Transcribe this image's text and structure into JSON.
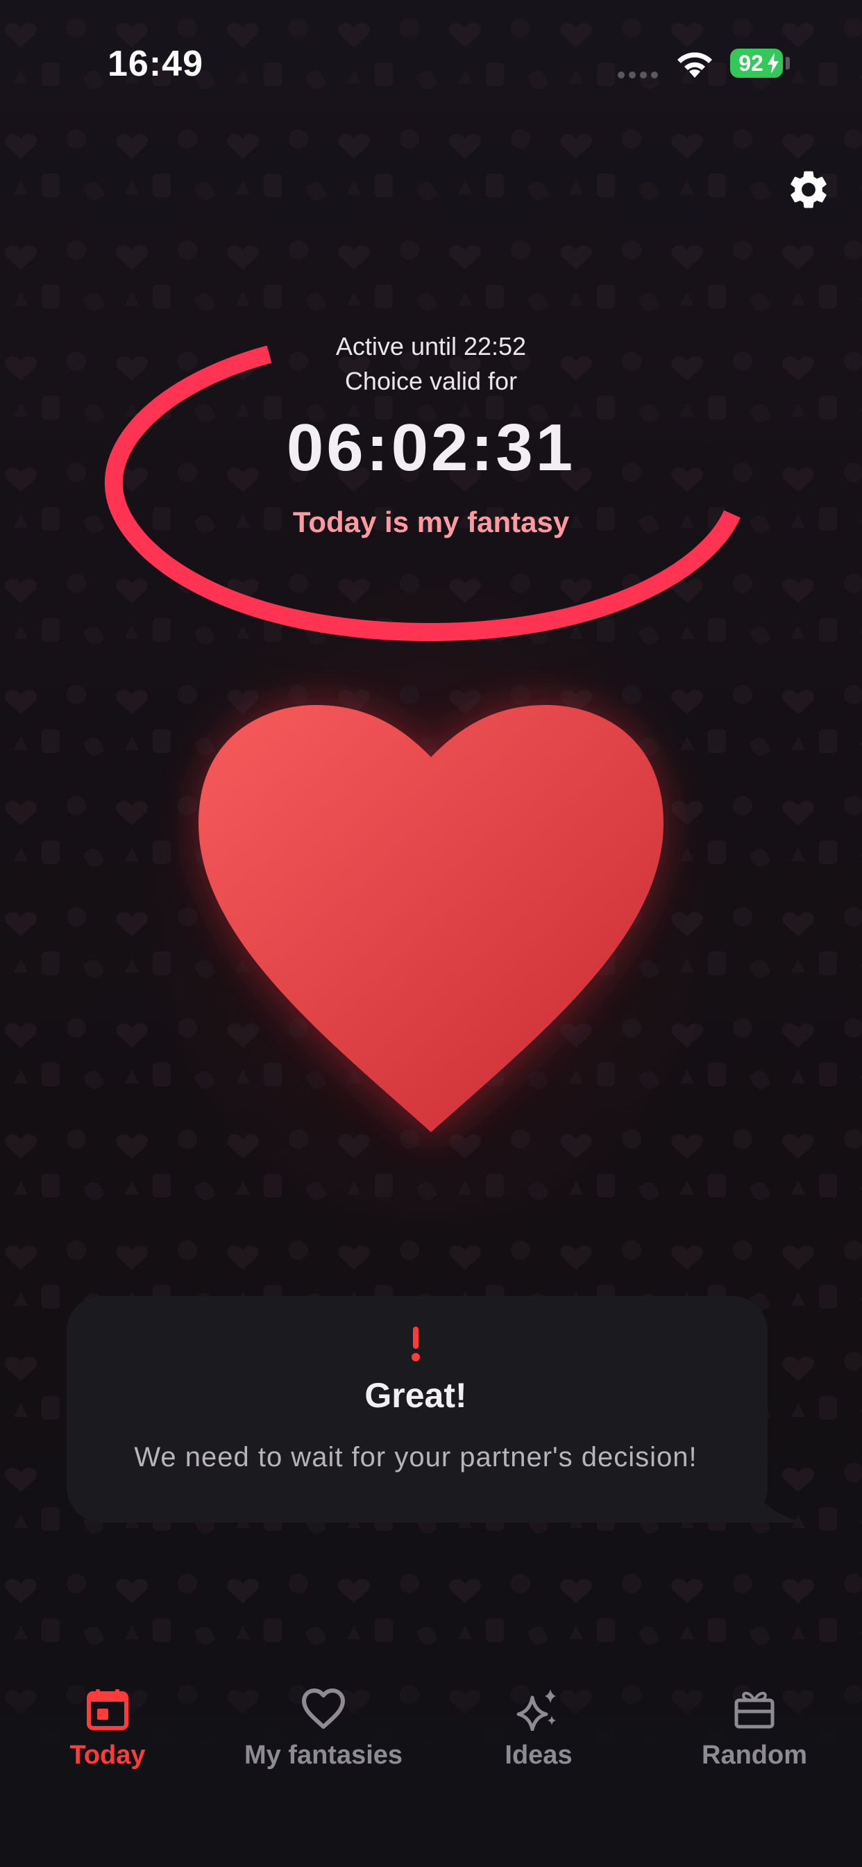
{
  "status_bar": {
    "time": "16:49",
    "battery": "92"
  },
  "icons": {
    "settings": "gear-icon",
    "wifi": "wifi-icon",
    "battery": "battery-icon",
    "heart": "heart-icon",
    "alert": "exclamation-icon"
  },
  "timer": {
    "active_until": "Active until 22:52",
    "choice_valid": "Choice valid for",
    "countdown": "06:02:31",
    "status": "Today is my fantasy"
  },
  "notification": {
    "title": "Great!",
    "message": "We need to wait for your partner's decision!"
  },
  "tabs": [
    {
      "label": "Today",
      "icon": "calendar-icon",
      "active": true
    },
    {
      "label": "My fantasies",
      "icon": "heart-outline-icon",
      "active": false
    },
    {
      "label": "Ideas",
      "icon": "sparkles-icon",
      "active": false
    },
    {
      "label": "Random",
      "icon": "gift-icon",
      "active": false
    }
  ],
  "colors": {
    "accent": "#ff3352",
    "active_tab": "#ff3b3b",
    "heart_light": "#f25a5a",
    "heart_dark": "#c92f36",
    "background": "#151216",
    "card": "#1b1a1f",
    "battery": "#34c759"
  }
}
